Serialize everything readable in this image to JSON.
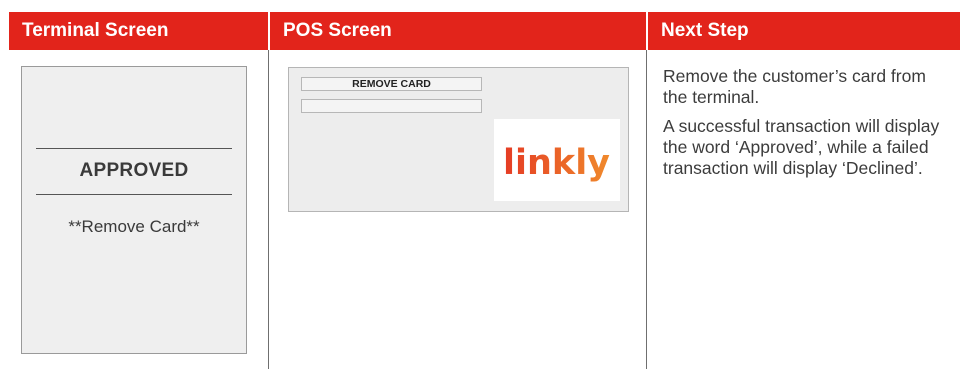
{
  "header": {
    "terminal_title": "Terminal Screen",
    "pos_title": "POS Screen",
    "next_title": "Next Step"
  },
  "terminal": {
    "status": "APPROVED",
    "message": "**Remove Card**"
  },
  "pos": {
    "line1": "REMOVE CARD",
    "line2": "",
    "logo_text": "linkly"
  },
  "next_step": {
    "para1": "Remove the customer’s card from the terminal.",
    "para2": "A successful transaction will display the word ‘Approved’, while a failed transaction will display ‘Declined’."
  },
  "colors": {
    "header_bg": "#e2241b",
    "logo_orange": "#f08a2c",
    "logo_red": "#e53b24"
  }
}
